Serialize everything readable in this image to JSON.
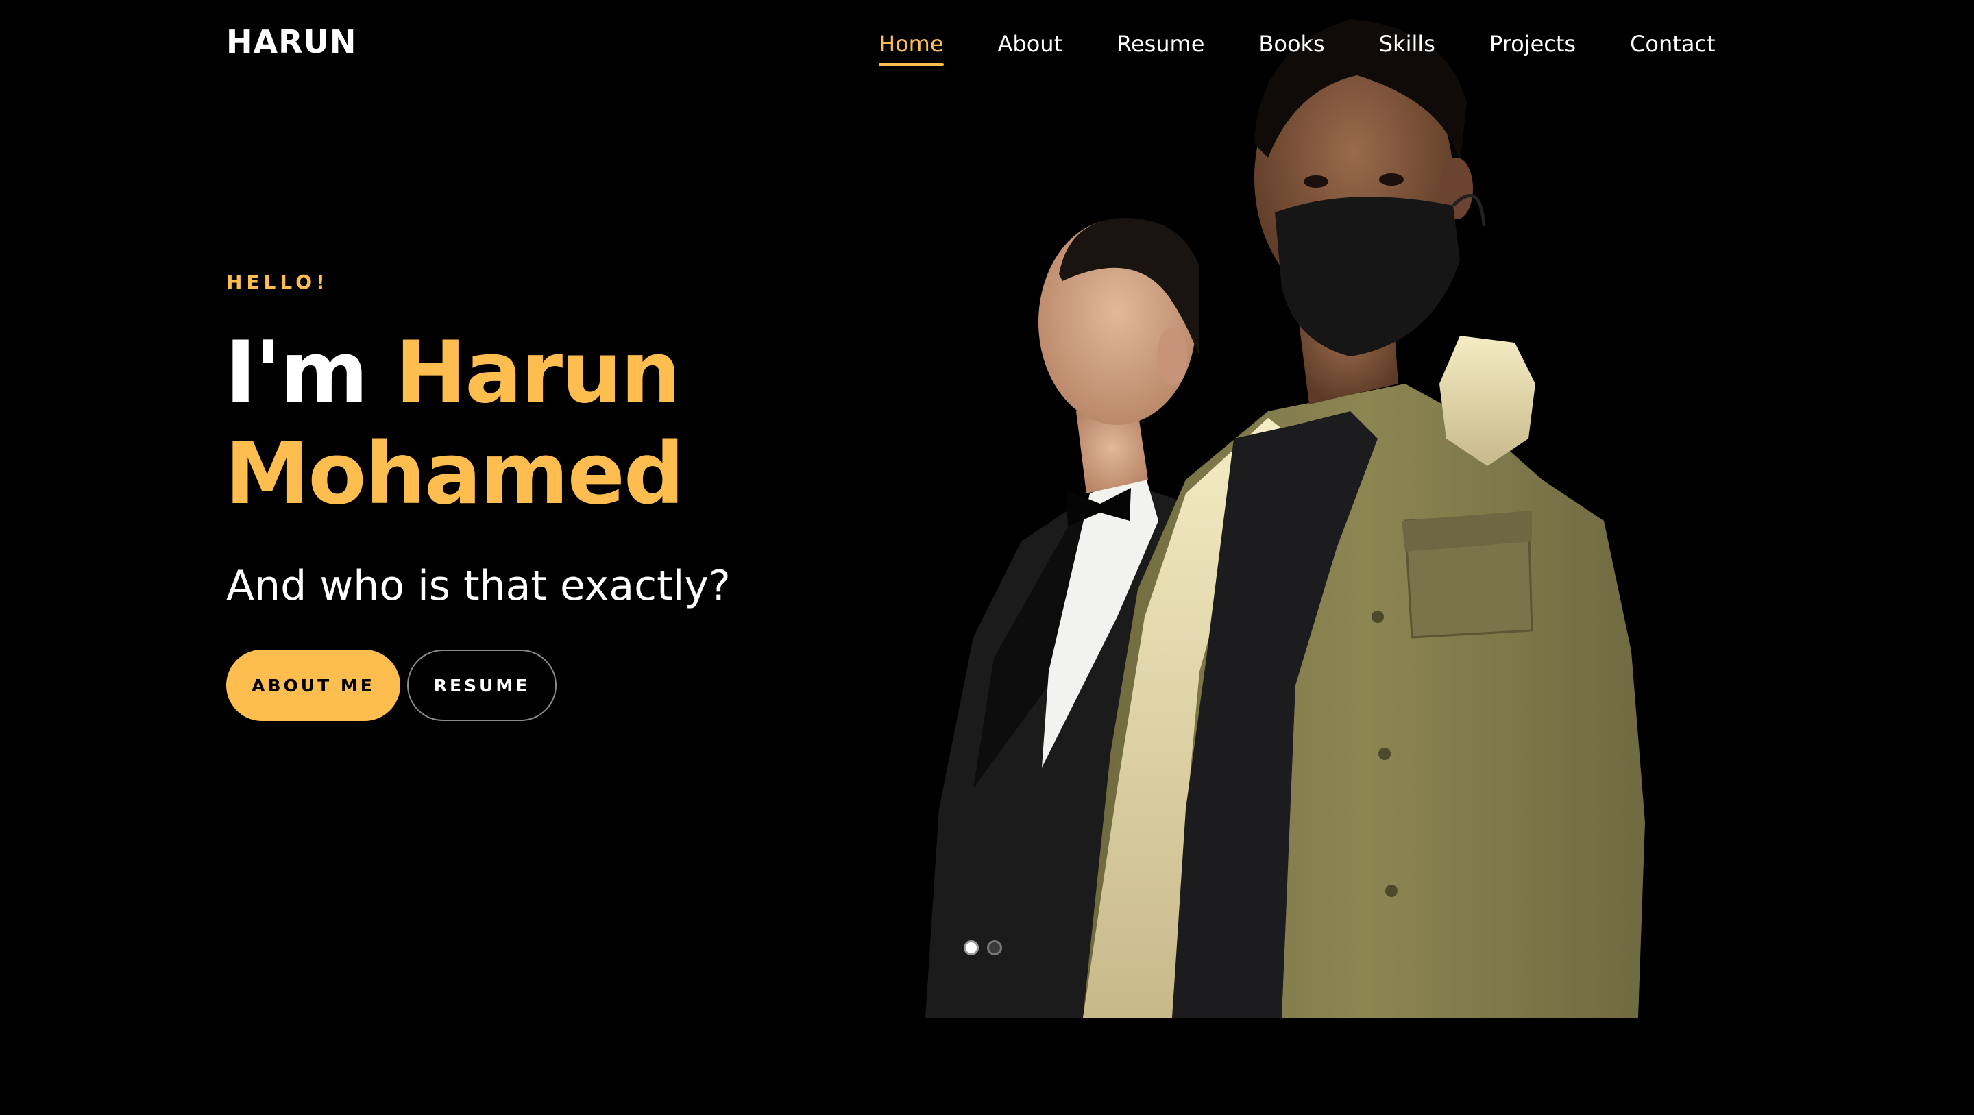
{
  "brand": {
    "logo_text": "HARUN",
    "accent_color": "#fdbe4f",
    "background_color": "#000000"
  },
  "nav": {
    "items": [
      {
        "label": "Home",
        "active": true
      },
      {
        "label": "About",
        "active": false
      },
      {
        "label": "Resume",
        "active": false
      },
      {
        "label": "Books",
        "active": false
      },
      {
        "label": "Skills",
        "active": false
      },
      {
        "label": "Projects",
        "active": false
      },
      {
        "label": "Contact",
        "active": false
      }
    ]
  },
  "hero": {
    "greeting": "HELLO!",
    "headline_prefix": "I'm",
    "headline_name_first": "Harun",
    "headline_name_last": "Mohamed",
    "subheading": "And who is that exactly?",
    "primary_button": "ABOUT ME",
    "secondary_button": "RESUME",
    "carousel": {
      "slide_count": 2,
      "active_slide": 1
    }
  }
}
